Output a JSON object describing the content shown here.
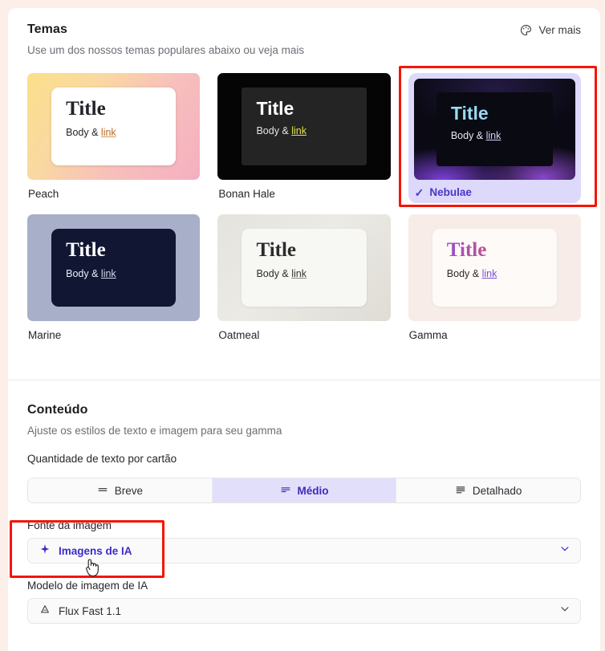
{
  "themes": {
    "title": "Temas",
    "subtitle": "Use um dos nossos temas populares abaixo ou veja mais",
    "see_more_label": "Ver mais",
    "see_more_icon": "palette-icon",
    "selected_check": "✓",
    "items": [
      {
        "name": "Peach",
        "title": "Title",
        "body": "Body & ",
        "link": "link",
        "selected": false
      },
      {
        "name": "Bonan Hale",
        "title": "Title",
        "body": "Body & ",
        "link": "link",
        "selected": false
      },
      {
        "name": "Nebulae",
        "title": "Title",
        "body": "Body & ",
        "link": "link",
        "selected": true
      },
      {
        "name": "Marine",
        "title": "Title",
        "body": "Body & ",
        "link": "link",
        "selected": false
      },
      {
        "name": "Oatmeal",
        "title": "Title",
        "body": "Body & ",
        "link": "link",
        "selected": false
      },
      {
        "name": "Gamma",
        "title": "Title",
        "body": "Body & ",
        "link": "link",
        "selected": false
      }
    ]
  },
  "content": {
    "title": "Conteúdo",
    "subtitle": "Ajuste os estilos de texto e imagem para seu gamma",
    "text_amount": {
      "label": "Quantidade de texto por cartão",
      "options": [
        {
          "label": "Breve",
          "icon": "lines-1-icon",
          "active": false
        },
        {
          "label": "Médio",
          "icon": "lines-2-icon",
          "active": true
        },
        {
          "label": "Detalhado",
          "icon": "lines-3-icon",
          "active": false
        }
      ]
    },
    "image_source": {
      "label": "Fonte da imagem",
      "value": "Imagens de IA",
      "icon": "sparkle-icon",
      "chevron": "chevron-down-icon"
    },
    "image_model": {
      "label": "Modelo de imagem de IA",
      "value": "Flux Fast 1.1",
      "icon": "flux-triangle-icon",
      "chevron": "chevron-down-icon"
    }
  },
  "annotations": {
    "highlight_color": "#f51505",
    "accent_color": "#3a2bc9",
    "selected_bg": "#ddd9fb",
    "page_bg": "#fceee9",
    "cursor": "pointer-hand-cursor"
  }
}
